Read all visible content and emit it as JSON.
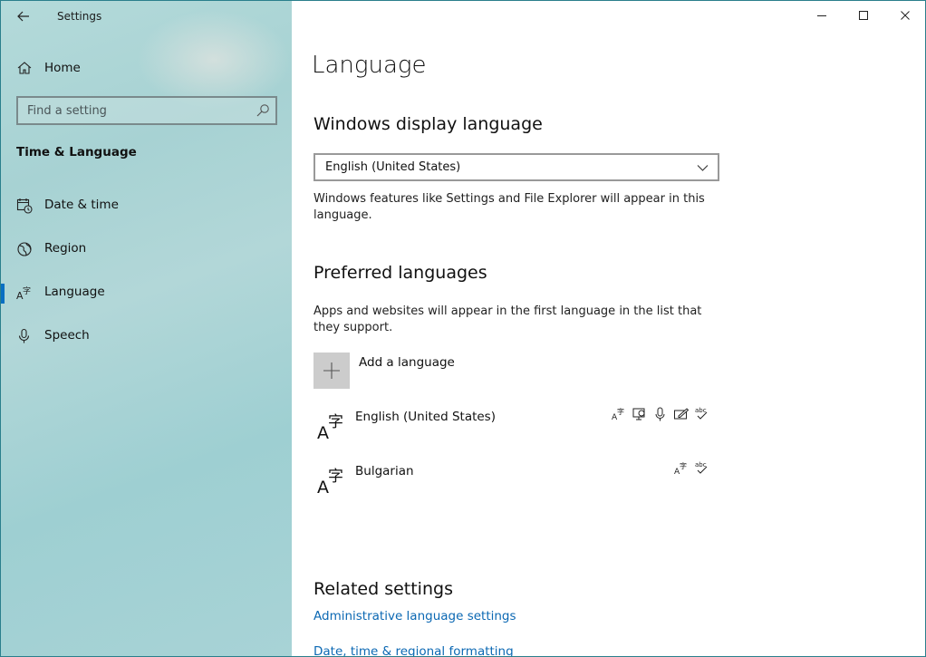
{
  "window": {
    "app_title": "Settings",
    "controls": [
      "minimize-icon",
      "maximize-icon",
      "close-icon"
    ]
  },
  "sidebar": {
    "home_label": "Home",
    "search_placeholder": "Find a setting",
    "section_heading": "Time & Language",
    "items": [
      {
        "label": "Date & time",
        "icon": "calendar-clock-icon",
        "selected": false
      },
      {
        "label": "Region",
        "icon": "globe-icon",
        "selected": false
      },
      {
        "label": "Language",
        "icon": "language-icon",
        "selected": true
      },
      {
        "label": "Speech",
        "icon": "microphone-icon",
        "selected": false
      }
    ],
    "accent_color": "#0a6fc2"
  },
  "main": {
    "title": "Language",
    "display_language": {
      "heading": "Windows display language",
      "selected_value": "English (United States)",
      "description": "Windows features like Settings and File Explorer will appear in this language."
    },
    "preferred": {
      "heading": "Preferred languages",
      "description": "Apps and websites will appear in the first language in the list that they support.",
      "add_label": "Add a language",
      "languages": [
        {
          "name": "English (United States)",
          "capabilities": [
            "language-pack-icon",
            "display-icon",
            "speech-icon",
            "handwriting-icon",
            "spelling-icon"
          ]
        },
        {
          "name": "Bulgarian",
          "capabilities": [
            "language-pack-icon",
            "spelling-icon"
          ]
        }
      ]
    },
    "related": {
      "heading": "Related settings",
      "links": [
        "Administrative language settings",
        "Date, time & regional formatting"
      ]
    },
    "link_color": "#0b68b3"
  }
}
